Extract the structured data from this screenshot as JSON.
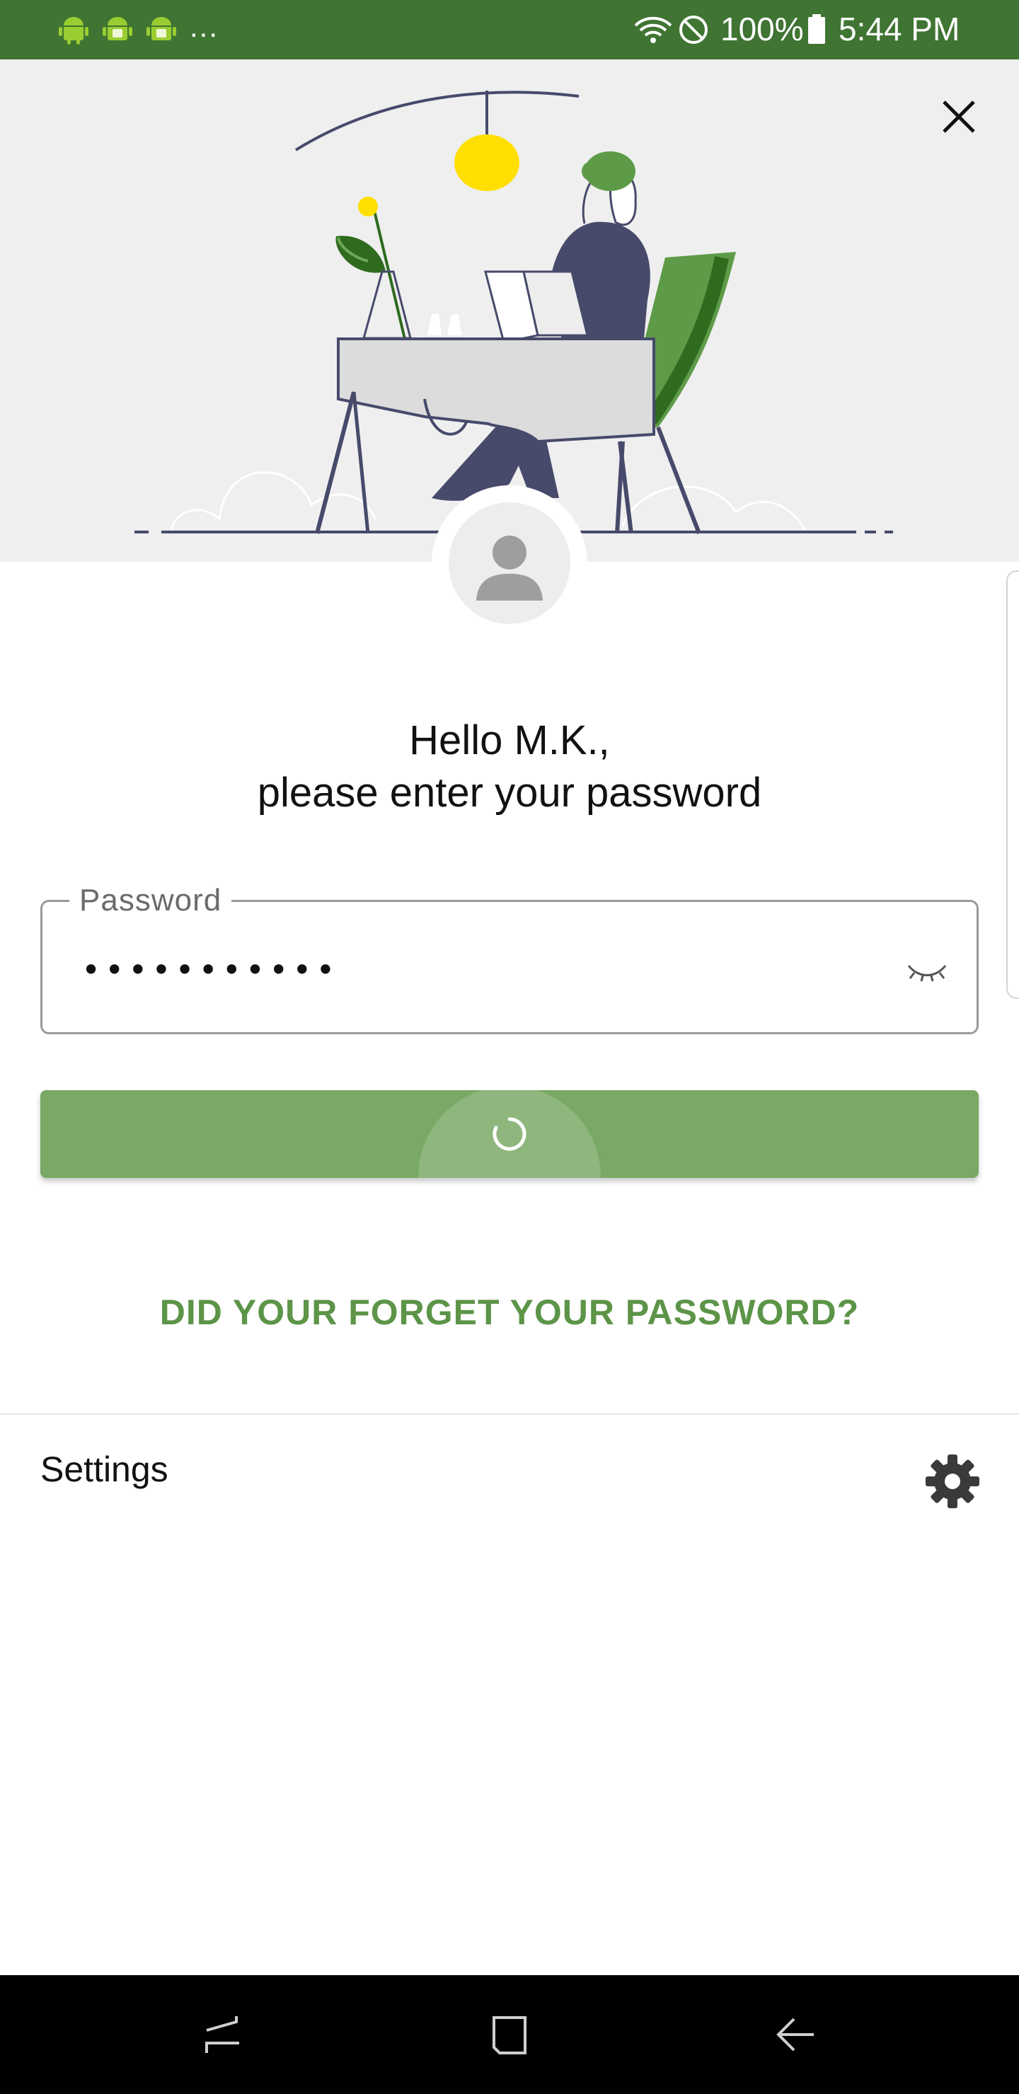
{
  "status_bar": {
    "notification_icons": [
      "android-icon",
      "android-app-icon",
      "android-app-icon"
    ],
    "overflow": "...",
    "system_icons": [
      "wifi-icon",
      "do-not-disturb-icon",
      "battery-icon"
    ],
    "battery": "100%",
    "time": "5:44 PM",
    "bar_color": "#3f7432"
  },
  "header": {
    "illustration": "person-reading-at-desk-illustration",
    "close_icon": "close-icon"
  },
  "avatar": {
    "icon": "user-avatar-icon"
  },
  "greeting": {
    "line1": "Hello M.K.,",
    "line2": "please enter your password"
  },
  "password_field": {
    "label": "Password",
    "value": "•••••••••••",
    "toggle_icon": "eye-closed-icon"
  },
  "submit_button": {
    "state": "loading",
    "icon": "loading-spinner-icon",
    "color": "#79a965"
  },
  "forgot_link": {
    "label": "DID YOUR FORGET YOUR PASSWORD?",
    "color": "#5c9448"
  },
  "settings": {
    "label": "Settings",
    "icon": "gear-icon"
  },
  "nav_bar": {
    "buttons": [
      "recent-apps-icon",
      "home-icon",
      "back-icon"
    ]
  }
}
